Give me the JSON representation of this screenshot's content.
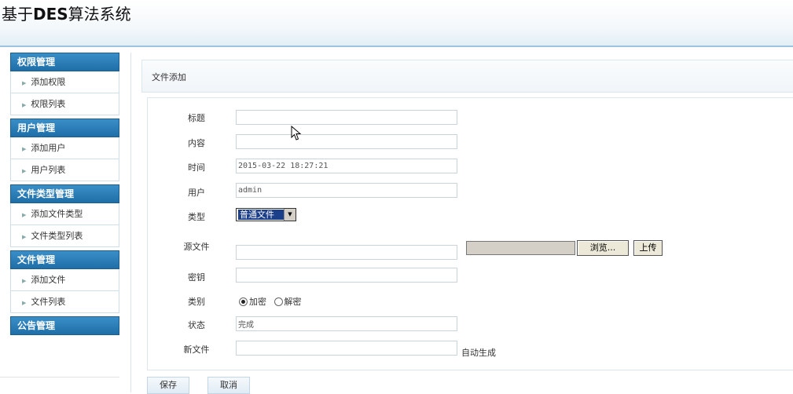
{
  "header": {
    "title_prefix": "基于",
    "title_bold": "DES",
    "title_suffix": "算法系统"
  },
  "sidebar": [
    {
      "title": "权限管理",
      "items": [
        "添加权限",
        "权限列表"
      ]
    },
    {
      "title": "用户管理",
      "items": [
        "添加用户",
        "用户列表"
      ]
    },
    {
      "title": "文件类型管理",
      "items": [
        "添加文件类型",
        "文件类型列表"
      ]
    },
    {
      "title": "文件管理",
      "items": [
        "添加文件",
        "文件列表"
      ]
    },
    {
      "title": "公告管理",
      "items": []
    }
  ],
  "section": {
    "title": "文件添加"
  },
  "form": {
    "title_label": "标题",
    "title_value": "",
    "content_label": "内容",
    "content_value": "",
    "time_label": "时间",
    "time_value": "2015-03-22 18:27:21",
    "user_label": "用户",
    "user_value": "admin",
    "type_label": "类型",
    "type_selected": "普通文件",
    "source_label": "源文件",
    "source_value": "",
    "browse_label": "浏览...",
    "upload_label": "上传",
    "key_label": "密钥",
    "key_value": "",
    "category_label": "类别",
    "category_options": [
      "加密",
      "解密"
    ],
    "category_selected": "加密",
    "status_label": "状态",
    "status_value": "完成",
    "newfile_label": "新文件",
    "newfile_value": "",
    "newfile_hint": "自动生成"
  },
  "actions": {
    "save": "保存",
    "cancel": "取消"
  }
}
